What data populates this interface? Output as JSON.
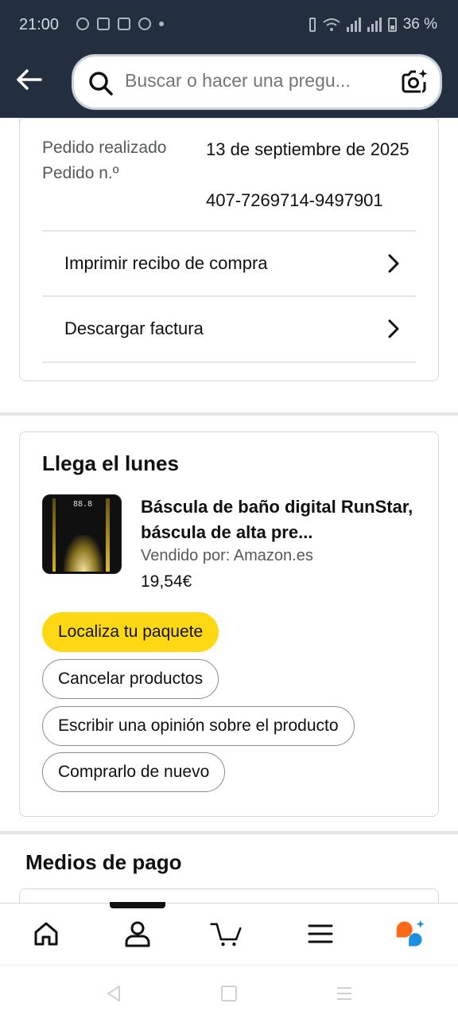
{
  "status_bar": {
    "time": "21:00",
    "battery": "36 %"
  },
  "search": {
    "placeholder": "Buscar o hacer una pregu..."
  },
  "order": {
    "date_label": "Pedido realizado",
    "date_value": "13 de septiembre de 2025",
    "number_label": "Pedido n.º",
    "number_value": "407-7269714-9497901",
    "links": [
      {
        "label": "Imprimir recibo de compra"
      },
      {
        "label": "Descargar factura"
      }
    ]
  },
  "delivery": {
    "arrival": "Llega el lunes",
    "product": {
      "title": "Báscula de baño digital RunStar, báscula de alta pre...",
      "seller": "Vendido por: Amazon.es",
      "price": "19,54€",
      "display_text": "88.8"
    },
    "buttons": [
      {
        "label": "Localiza tu paquete"
      },
      {
        "label": "Cancelar productos"
      },
      {
        "label": "Escribir una opinión sobre el producto"
      },
      {
        "label": "Comprarlo de nuevo"
      }
    ]
  },
  "payment": {
    "title": "Medios de pago"
  },
  "bottom_nav": {
    "items": [
      {
        "icon": "home-icon"
      },
      {
        "icon": "account-icon"
      },
      {
        "icon": "cart-icon"
      },
      {
        "icon": "menu-icon"
      },
      {
        "icon": "rufus-assistant-icon"
      }
    ]
  },
  "colors": {
    "header_bg": "#232f3e",
    "primary_button": "#ffd814",
    "assistant_orange": "#ff6a1a",
    "assistant_blue": "#1d8fe1"
  }
}
